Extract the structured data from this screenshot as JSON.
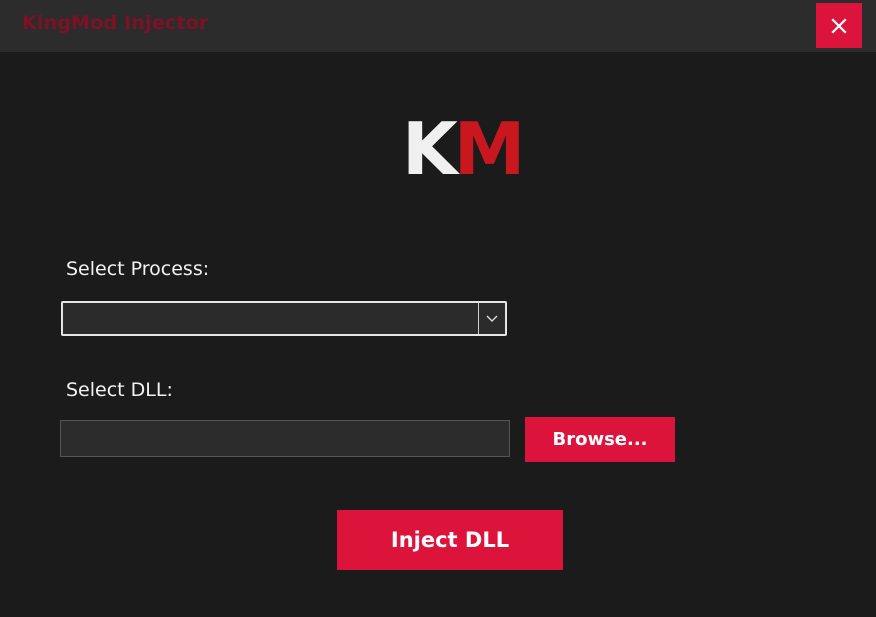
{
  "window": {
    "title": "KingMod Injector",
    "close_icon": "close-icon",
    "accent_color": "#dc143c"
  },
  "logo": {
    "letter_k": "K",
    "letter_m": "M",
    "k_color": "#f0f0f0",
    "m_color": "#c8171e"
  },
  "process": {
    "label": "Select Process:",
    "selected_value": "",
    "dropdown_icon": "chevron-down-icon"
  },
  "dll": {
    "label": "Select DLL:",
    "path_value": "",
    "browse_label": "Browse..."
  },
  "actions": {
    "inject_label": "Inject DLL"
  }
}
